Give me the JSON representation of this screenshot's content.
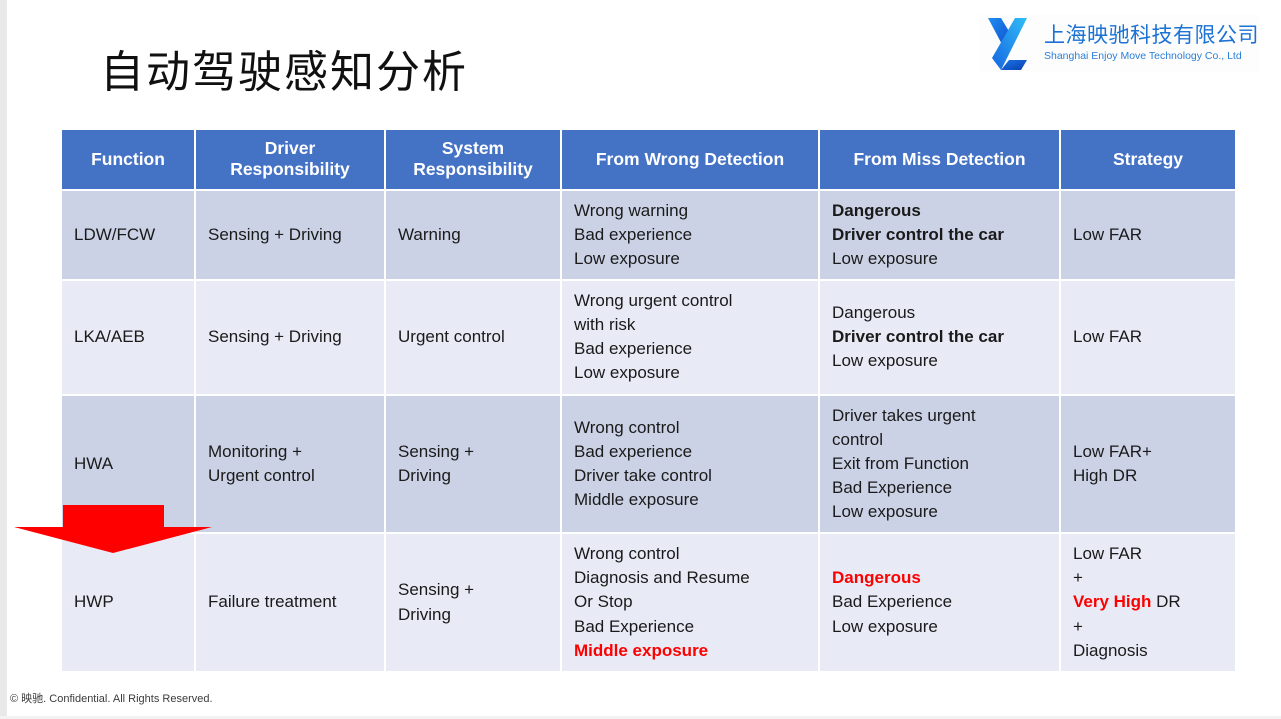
{
  "slide": {
    "title": "自动驾驶感知分析",
    "footer": "© 映驰. Confidential. All Rights Reserved.",
    "accent_header_color": "#4472C4",
    "row_dark_color": "#CCD2E6",
    "row_light_color": "#E8EBF5",
    "highlight_color": "#FF0000"
  },
  "logo": {
    "name_cn": "上海映驰科技有限公司",
    "name_en": "Shanghai Enjoy Move Technology Co., Ltd",
    "mark": "stylized-y-logo",
    "color_dark": "#1565E0",
    "color_light": "#29B6F6"
  },
  "table": {
    "headers": [
      "Function",
      "Driver\nResponsibility",
      "System\nResponsibility",
      "From Wrong Detection",
      "From Miss Detection",
      "Strategy"
    ],
    "headers_split": [
      [
        "Function"
      ],
      [
        "Driver",
        "Responsibility"
      ],
      [
        "System",
        "Responsibility"
      ],
      [
        "From Wrong Detection"
      ],
      [
        "From Miss Detection"
      ],
      [
        "Strategy"
      ]
    ],
    "rows": [
      {
        "function": "LDW/FCW",
        "driver_responsibility": [
          "Sensing + Driving"
        ],
        "system_responsibility": [
          "Warning"
        ],
        "from_wrong_detection": [
          {
            "text": "Wrong warning",
            "bold": false,
            "red": false
          },
          {
            "text": "Bad experience",
            "bold": false,
            "red": false
          },
          {
            "text": "Low exposure",
            "bold": false,
            "red": false
          }
        ],
        "from_miss_detection": [
          {
            "text": "Dangerous",
            "bold": true,
            "red": false
          },
          {
            "text": "Driver control the car",
            "bold": true,
            "red": false
          },
          {
            "text": "Low exposure",
            "bold": false,
            "red": false
          }
        ],
        "strategy": [
          {
            "text": "Low FAR",
            "bold": false,
            "red": false
          }
        ]
      },
      {
        "function": "LKA/AEB",
        "driver_responsibility": [
          "Sensing + Driving"
        ],
        "system_responsibility": [
          "Urgent control"
        ],
        "from_wrong_detection": [
          {
            "text": "Wrong urgent control",
            "bold": false,
            "red": false
          },
          {
            "text": "with risk",
            "bold": false,
            "red": false
          },
          {
            "text": "Bad experience",
            "bold": false,
            "red": false
          },
          {
            "text": "Low exposure",
            "bold": false,
            "red": false
          }
        ],
        "from_miss_detection": [
          {
            "text": "Dangerous",
            "bold": false,
            "red": false
          },
          {
            "text": "Driver control the car",
            "bold": true,
            "red": false
          },
          {
            "text": "Low exposure",
            "bold": false,
            "red": false
          }
        ],
        "strategy": [
          {
            "text": "Low FAR",
            "bold": false,
            "red": false
          }
        ]
      },
      {
        "function": "HWA",
        "driver_responsibility": [
          "Monitoring +",
          "Urgent control"
        ],
        "system_responsibility": [
          "Sensing +",
          "Driving"
        ],
        "from_wrong_detection": [
          {
            "text": "Wrong control",
            "bold": false,
            "red": false
          },
          {
            "text": "Bad experience",
            "bold": false,
            "red": false
          },
          {
            "text": "Driver take control",
            "bold": false,
            "red": false
          },
          {
            "text": "Middle exposure",
            "bold": false,
            "red": false
          }
        ],
        "from_miss_detection": [
          {
            "text": "Driver takes urgent",
            "bold": false,
            "red": false
          },
          {
            "text": "control",
            "bold": false,
            "red": false
          },
          {
            "text": "Exit from Function",
            "bold": false,
            "red": false
          },
          {
            "text": "Bad Experience",
            "bold": false,
            "red": false
          },
          {
            "text": "Low exposure",
            "bold": false,
            "red": false
          }
        ],
        "strategy": [
          {
            "text": "Low FAR+",
            "bold": false,
            "red": false
          },
          {
            "text": "High DR",
            "bold": false,
            "red": false
          }
        ]
      },
      {
        "function": "HWP",
        "driver_responsibility": [
          "Failure treatment"
        ],
        "system_responsibility": [
          "Sensing +",
          "Driving"
        ],
        "from_wrong_detection": [
          {
            "text": "Wrong control",
            "bold": false,
            "red": false
          },
          {
            "text": "Diagnosis and Resume",
            "bold": false,
            "red": false
          },
          {
            "text": "Or Stop",
            "bold": false,
            "red": false
          },
          {
            "text": "Bad Experience",
            "bold": false,
            "red": false
          },
          {
            "text": "Middle exposure",
            "bold": true,
            "red": true
          }
        ],
        "from_miss_detection": [
          {
            "text": "Dangerous",
            "bold": true,
            "red": true
          },
          {
            "text": "Bad Experience",
            "bold": false,
            "red": false
          },
          {
            "text": "Low exposure",
            "bold": false,
            "red": false
          }
        ],
        "strategy": [
          {
            "text": "Low FAR",
            "bold": false,
            "red": false
          },
          {
            "text": "+",
            "bold": false,
            "red": false
          },
          {
            "text": "Very High DR",
            "bold": false,
            "red": false,
            "partial_red_bold": "Very High"
          },
          {
            "text": "+",
            "bold": false,
            "red": false
          },
          {
            "text": "Diagnosis",
            "bold": false,
            "red": false
          }
        ]
      }
    ]
  },
  "annotation": {
    "arrow": "red-down-arrow",
    "points_at_row": "HWP"
  }
}
